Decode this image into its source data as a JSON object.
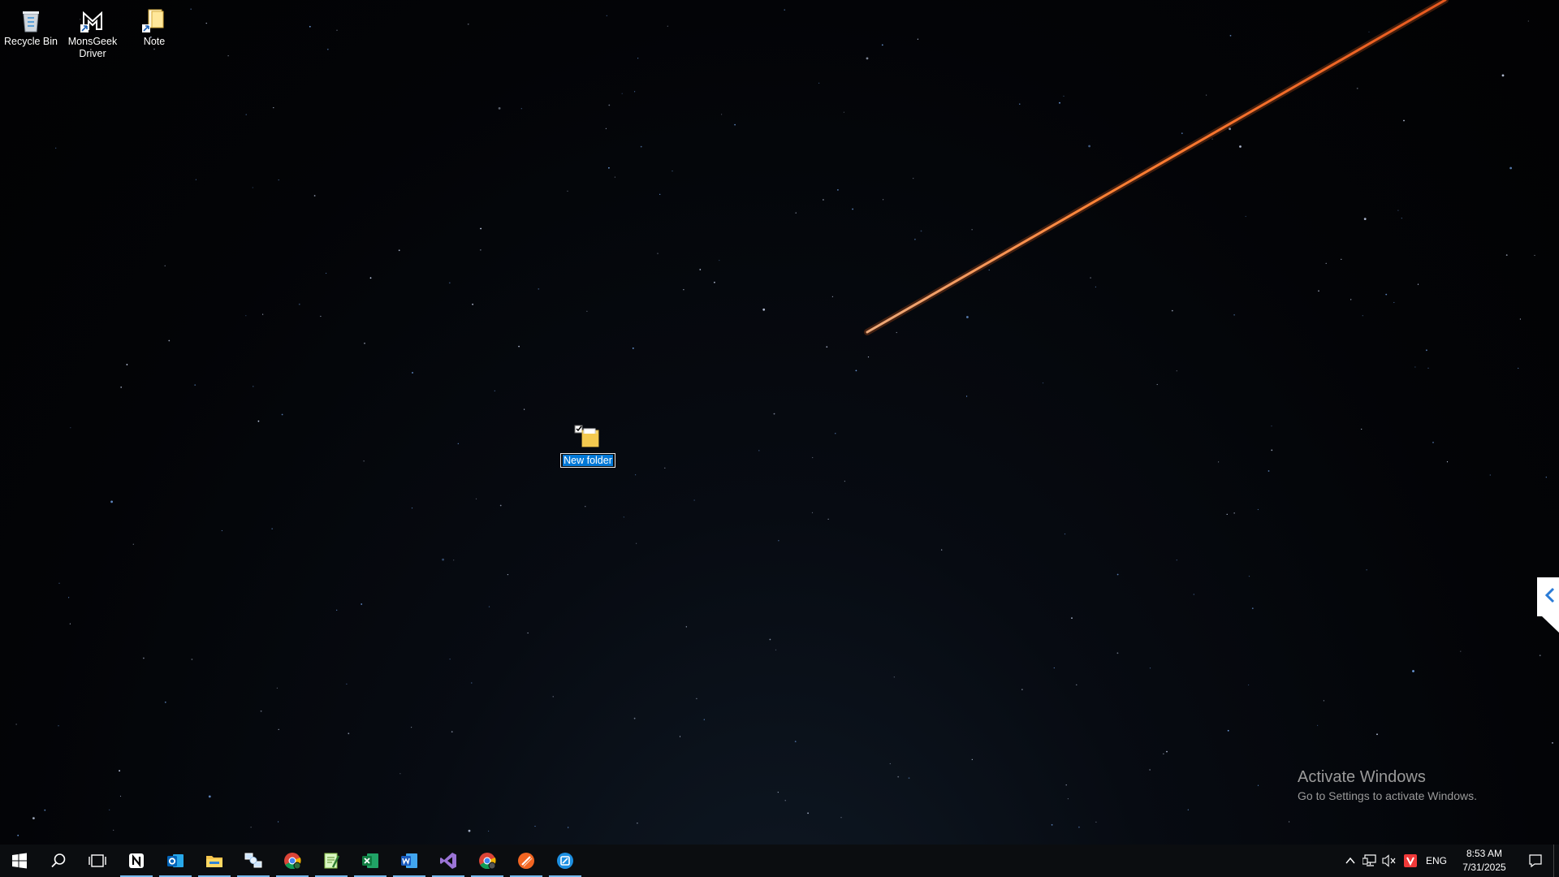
{
  "desktop": {
    "icons": [
      {
        "label": "Recycle Bin",
        "icon": "recycle-bin-icon"
      },
      {
        "label": "MonsGeek Driver",
        "icon": "monsgeek-driver-icon"
      },
      {
        "label": "Note",
        "icon": "note-file-icon"
      }
    ],
    "new_folder": {
      "label": "New folder",
      "icon": "folder-icon",
      "state": "renaming",
      "selected": true
    }
  },
  "watermark": {
    "title": "Activate Windows",
    "subtitle": "Go to Settings to activate Windows."
  },
  "taskbar": {
    "start": "windows-start-icon",
    "search": "search-icon",
    "task_view": "task-view-icon",
    "apps": [
      {
        "name": "notion-icon",
        "running": true
      },
      {
        "name": "outlook-icon",
        "running": true
      },
      {
        "name": "file-explorer-icon",
        "running": true
      },
      {
        "name": "network-tool-icon",
        "running": true
      },
      {
        "name": "chrome-icon",
        "running": true
      },
      {
        "name": "notepad-plus-icon",
        "running": true
      },
      {
        "name": "excel-icon",
        "running": true
      },
      {
        "name": "word-icon",
        "running": true
      },
      {
        "name": "visual-studio-icon",
        "running": true
      },
      {
        "name": "chrome-profile-icon",
        "running": true
      },
      {
        "name": "orange-app-icon",
        "running": true
      },
      {
        "name": "blue-app-icon",
        "running": true
      }
    ],
    "tray": {
      "chevron": "chevron-up-icon",
      "network": "network-icon",
      "volume": "volume-muted-icon",
      "vivaldi": "vivaldi-icon",
      "language": "ENG",
      "time": "8:53 AM",
      "date": "7/31/2025",
      "notifications": "notification-icon"
    }
  },
  "colors": {
    "taskbar": "#0b0d10",
    "accent_underline": "#76b9ed",
    "selection": "#0078d7",
    "meteor": "#ff7a3c"
  }
}
